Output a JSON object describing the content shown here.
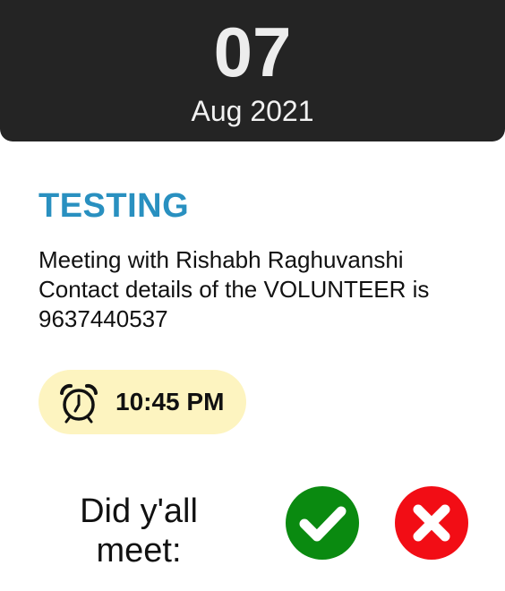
{
  "date": {
    "day": "07",
    "month_year": "Aug 2021"
  },
  "event": {
    "title": "TESTING",
    "description_lines": [
      "Meeting with Rishabh Raghuvanshi",
      "Contact details of the VOLUNTEER is",
      "9637440537"
    ],
    "time": "10:45 PM",
    "time_icon": "alarm-clock-icon"
  },
  "confirmation": {
    "question_lines": [
      "Did y'all",
      "meet:"
    ],
    "yes_icon": "checkmark-icon",
    "no_icon": "cross-icon"
  },
  "colors": {
    "header_bg": "#242424",
    "title": "#2990c0",
    "time_pill_bg": "#fdf4c0",
    "yes_button": "#0a8a10",
    "no_button": "#f20d15"
  }
}
